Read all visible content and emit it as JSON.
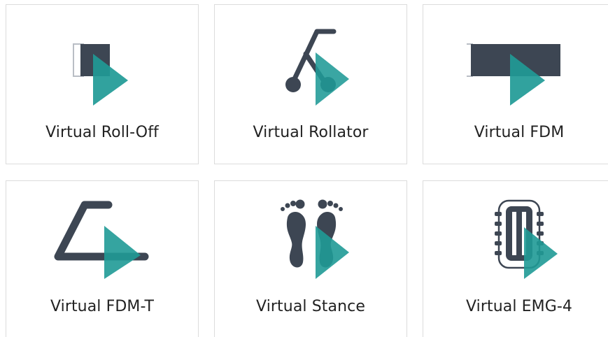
{
  "colors": {
    "dark": "#3d4653",
    "teal": "#1f9a96",
    "tile_border": "#dcdcdc"
  },
  "tiles": [
    {
      "label": "Virtual Roll-Off",
      "icon": "roll-off-icon"
    },
    {
      "label": "Virtual Rollator",
      "icon": "rollator-icon"
    },
    {
      "label": "Virtual FDM",
      "icon": "fdm-icon"
    },
    {
      "label": "Virtual FDM-T",
      "icon": "fdm-t-icon"
    },
    {
      "label": "Virtual Stance",
      "icon": "stance-icon"
    },
    {
      "label": "Virtual EMG-4",
      "icon": "emg-4-icon"
    }
  ]
}
